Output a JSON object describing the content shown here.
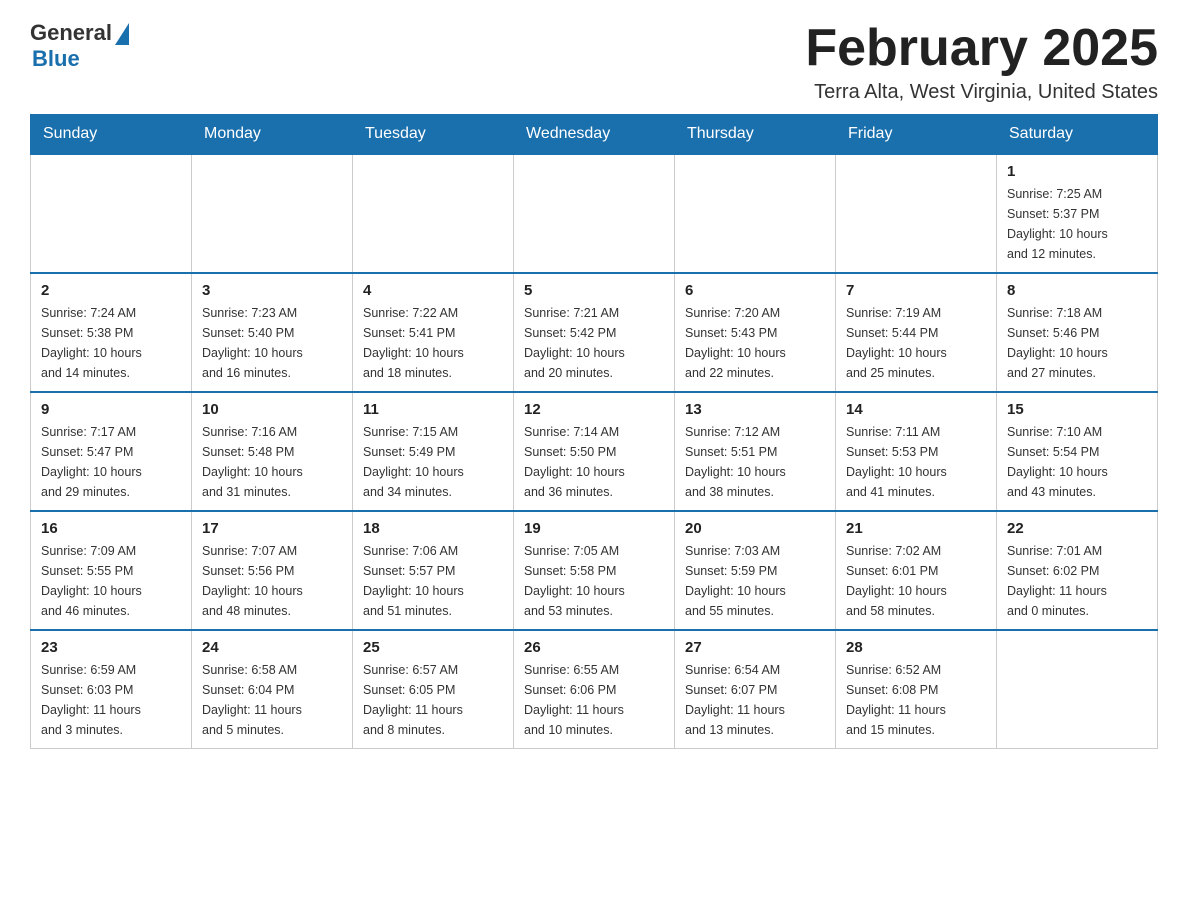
{
  "logo": {
    "general": "General",
    "blue": "Blue"
  },
  "title": "February 2025",
  "subtitle": "Terra Alta, West Virginia, United States",
  "days_of_week": [
    "Sunday",
    "Monday",
    "Tuesday",
    "Wednesday",
    "Thursday",
    "Friday",
    "Saturday"
  ],
  "weeks": [
    [
      {
        "day": "",
        "info": ""
      },
      {
        "day": "",
        "info": ""
      },
      {
        "day": "",
        "info": ""
      },
      {
        "day": "",
        "info": ""
      },
      {
        "day": "",
        "info": ""
      },
      {
        "day": "",
        "info": ""
      },
      {
        "day": "1",
        "info": "Sunrise: 7:25 AM\nSunset: 5:37 PM\nDaylight: 10 hours\nand 12 minutes."
      }
    ],
    [
      {
        "day": "2",
        "info": "Sunrise: 7:24 AM\nSunset: 5:38 PM\nDaylight: 10 hours\nand 14 minutes."
      },
      {
        "day": "3",
        "info": "Sunrise: 7:23 AM\nSunset: 5:40 PM\nDaylight: 10 hours\nand 16 minutes."
      },
      {
        "day": "4",
        "info": "Sunrise: 7:22 AM\nSunset: 5:41 PM\nDaylight: 10 hours\nand 18 minutes."
      },
      {
        "day": "5",
        "info": "Sunrise: 7:21 AM\nSunset: 5:42 PM\nDaylight: 10 hours\nand 20 minutes."
      },
      {
        "day": "6",
        "info": "Sunrise: 7:20 AM\nSunset: 5:43 PM\nDaylight: 10 hours\nand 22 minutes."
      },
      {
        "day": "7",
        "info": "Sunrise: 7:19 AM\nSunset: 5:44 PM\nDaylight: 10 hours\nand 25 minutes."
      },
      {
        "day": "8",
        "info": "Sunrise: 7:18 AM\nSunset: 5:46 PM\nDaylight: 10 hours\nand 27 minutes."
      }
    ],
    [
      {
        "day": "9",
        "info": "Sunrise: 7:17 AM\nSunset: 5:47 PM\nDaylight: 10 hours\nand 29 minutes."
      },
      {
        "day": "10",
        "info": "Sunrise: 7:16 AM\nSunset: 5:48 PM\nDaylight: 10 hours\nand 31 minutes."
      },
      {
        "day": "11",
        "info": "Sunrise: 7:15 AM\nSunset: 5:49 PM\nDaylight: 10 hours\nand 34 minutes."
      },
      {
        "day": "12",
        "info": "Sunrise: 7:14 AM\nSunset: 5:50 PM\nDaylight: 10 hours\nand 36 minutes."
      },
      {
        "day": "13",
        "info": "Sunrise: 7:12 AM\nSunset: 5:51 PM\nDaylight: 10 hours\nand 38 minutes."
      },
      {
        "day": "14",
        "info": "Sunrise: 7:11 AM\nSunset: 5:53 PM\nDaylight: 10 hours\nand 41 minutes."
      },
      {
        "day": "15",
        "info": "Sunrise: 7:10 AM\nSunset: 5:54 PM\nDaylight: 10 hours\nand 43 minutes."
      }
    ],
    [
      {
        "day": "16",
        "info": "Sunrise: 7:09 AM\nSunset: 5:55 PM\nDaylight: 10 hours\nand 46 minutes."
      },
      {
        "day": "17",
        "info": "Sunrise: 7:07 AM\nSunset: 5:56 PM\nDaylight: 10 hours\nand 48 minutes."
      },
      {
        "day": "18",
        "info": "Sunrise: 7:06 AM\nSunset: 5:57 PM\nDaylight: 10 hours\nand 51 minutes."
      },
      {
        "day": "19",
        "info": "Sunrise: 7:05 AM\nSunset: 5:58 PM\nDaylight: 10 hours\nand 53 minutes."
      },
      {
        "day": "20",
        "info": "Sunrise: 7:03 AM\nSunset: 5:59 PM\nDaylight: 10 hours\nand 55 minutes."
      },
      {
        "day": "21",
        "info": "Sunrise: 7:02 AM\nSunset: 6:01 PM\nDaylight: 10 hours\nand 58 minutes."
      },
      {
        "day": "22",
        "info": "Sunrise: 7:01 AM\nSunset: 6:02 PM\nDaylight: 11 hours\nand 0 minutes."
      }
    ],
    [
      {
        "day": "23",
        "info": "Sunrise: 6:59 AM\nSunset: 6:03 PM\nDaylight: 11 hours\nand 3 minutes."
      },
      {
        "day": "24",
        "info": "Sunrise: 6:58 AM\nSunset: 6:04 PM\nDaylight: 11 hours\nand 5 minutes."
      },
      {
        "day": "25",
        "info": "Sunrise: 6:57 AM\nSunset: 6:05 PM\nDaylight: 11 hours\nand 8 minutes."
      },
      {
        "day": "26",
        "info": "Sunrise: 6:55 AM\nSunset: 6:06 PM\nDaylight: 11 hours\nand 10 minutes."
      },
      {
        "day": "27",
        "info": "Sunrise: 6:54 AM\nSunset: 6:07 PM\nDaylight: 11 hours\nand 13 minutes."
      },
      {
        "day": "28",
        "info": "Sunrise: 6:52 AM\nSunset: 6:08 PM\nDaylight: 11 hours\nand 15 minutes."
      },
      {
        "day": "",
        "info": ""
      }
    ]
  ]
}
